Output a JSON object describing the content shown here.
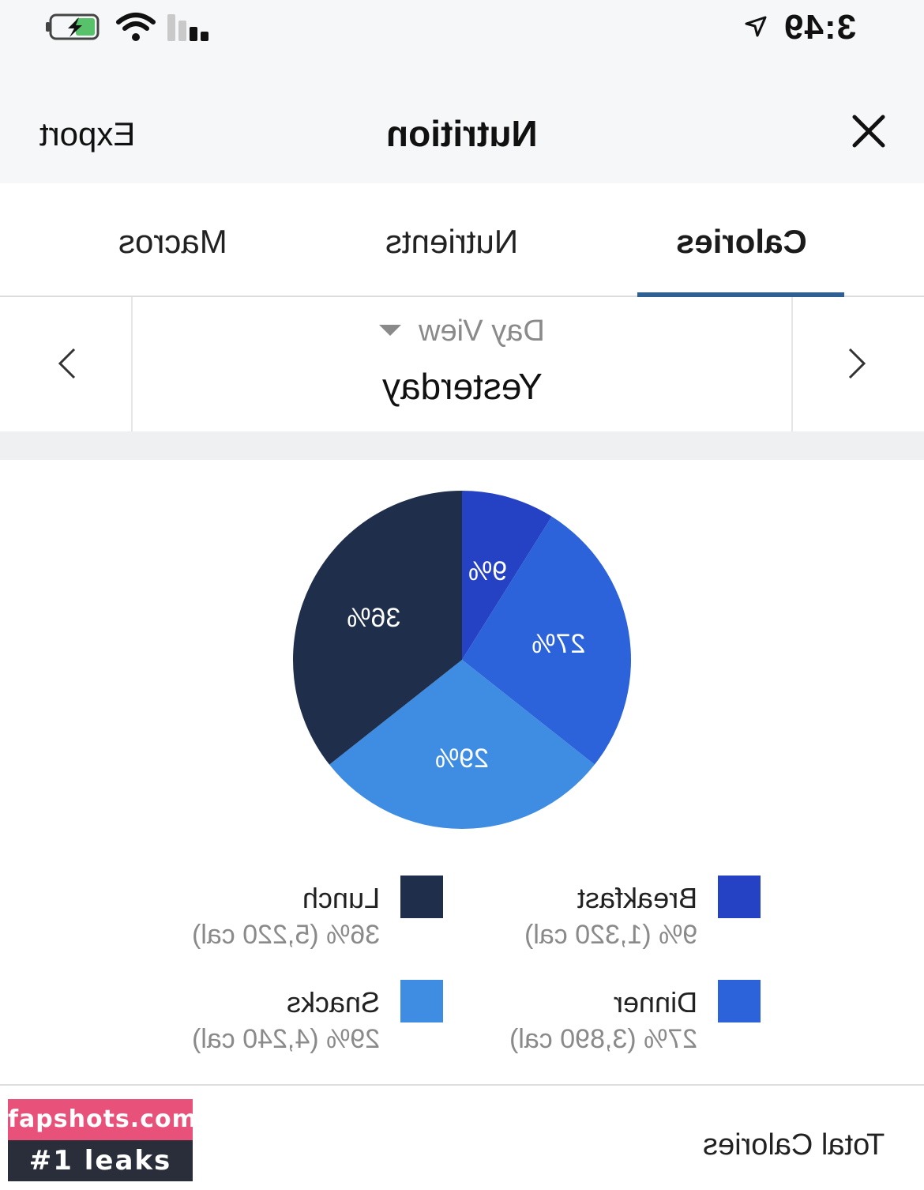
{
  "status_bar": {
    "time": "3:49",
    "icons": [
      "battery-charging-icon",
      "wifi-icon",
      "signal-icon",
      "location-arrow-icon"
    ]
  },
  "header": {
    "title": "Nutrition",
    "export_label": "Export",
    "close_icon": "close-icon"
  },
  "tabs": [
    {
      "label": "Calories",
      "active": true
    },
    {
      "label": "Nutrients",
      "active": false
    },
    {
      "label": "Macros",
      "active": false
    }
  ],
  "date_nav": {
    "view_label": "Day View",
    "date_label": "Yesterday",
    "prev_icon": "chevron-left-icon",
    "next_icon": "chevron-right-icon"
  },
  "colors": {
    "breakfast": "#2541c4",
    "dinner": "#2c63db",
    "snacks": "#3f8de2",
    "lunch": "#1f2f4b",
    "accent": "#2f5f93"
  },
  "chart_data": {
    "type": "pie",
    "labels": [
      "Breakfast",
      "Dinner",
      "Snacks",
      "Lunch"
    ],
    "values": [
      9,
      27,
      29,
      36
    ],
    "slice_labels": [
      "9%",
      "27%",
      "29%",
      "36%"
    ],
    "colors": [
      "#2541c4",
      "#2c63db",
      "#3f8de2",
      "#1f2f4b"
    ]
  },
  "legend": [
    {
      "name": "Breakfast",
      "detail": "9% (1,320 cal)"
    },
    {
      "name": "Lunch",
      "detail": "36% (5,220 cal)"
    },
    {
      "name": "Dinner",
      "detail": "27% (3,890 cal)"
    },
    {
      "name": "Snacks",
      "detail": "29% (4,240 cal)"
    }
  ],
  "totals": {
    "label": "Total Calories"
  },
  "watermark": {
    "line1": "fapshots.com",
    "line2": "#1 leaks"
  }
}
